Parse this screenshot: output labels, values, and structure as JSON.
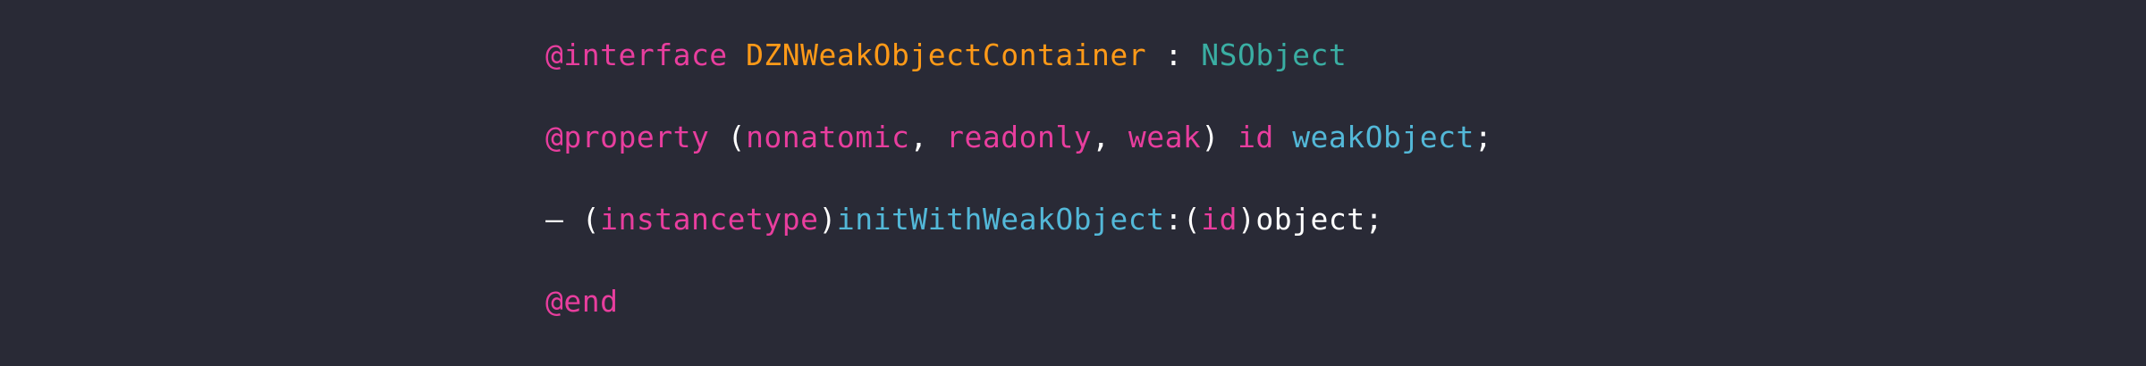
{
  "colors": {
    "background": "#292a36",
    "keyword": "#e83e9e",
    "class_name": "#ff9a18",
    "superclass": "#3aaea3",
    "identifier": "#53b8d8",
    "plain": "#ffffff"
  },
  "code": {
    "lines": [
      {
        "tokens": [
          {
            "text": "@interface",
            "kind": "keyword"
          },
          {
            "text": " ",
            "kind": "plain"
          },
          {
            "text": "DZNWeakObjectContainer",
            "kind": "class_name"
          },
          {
            "text": " : ",
            "kind": "plain"
          },
          {
            "text": "NSObject",
            "kind": "superclass"
          }
        ]
      },
      {
        "tokens": [
          {
            "text": "@property",
            "kind": "keyword"
          },
          {
            "text": " (",
            "kind": "plain"
          },
          {
            "text": "nonatomic",
            "kind": "keyword"
          },
          {
            "text": ", ",
            "kind": "plain"
          },
          {
            "text": "readonly",
            "kind": "keyword"
          },
          {
            "text": ", ",
            "kind": "plain"
          },
          {
            "text": "weak",
            "kind": "keyword"
          },
          {
            "text": ") ",
            "kind": "plain"
          },
          {
            "text": "id",
            "kind": "keyword"
          },
          {
            "text": " ",
            "kind": "plain"
          },
          {
            "text": "weakObject",
            "kind": "identifier"
          },
          {
            "text": ";",
            "kind": "plain"
          }
        ]
      },
      {
        "tokens": [
          {
            "text": "– (",
            "kind": "plain"
          },
          {
            "text": "instancetype",
            "kind": "keyword"
          },
          {
            "text": ")",
            "kind": "plain"
          },
          {
            "text": "initWithWeakObject",
            "kind": "identifier"
          },
          {
            "text": ":(",
            "kind": "plain"
          },
          {
            "text": "id",
            "kind": "keyword"
          },
          {
            "text": ")object;",
            "kind": "plain"
          }
        ]
      },
      {
        "tokens": [
          {
            "text": "@end",
            "kind": "keyword"
          }
        ]
      }
    ]
  }
}
